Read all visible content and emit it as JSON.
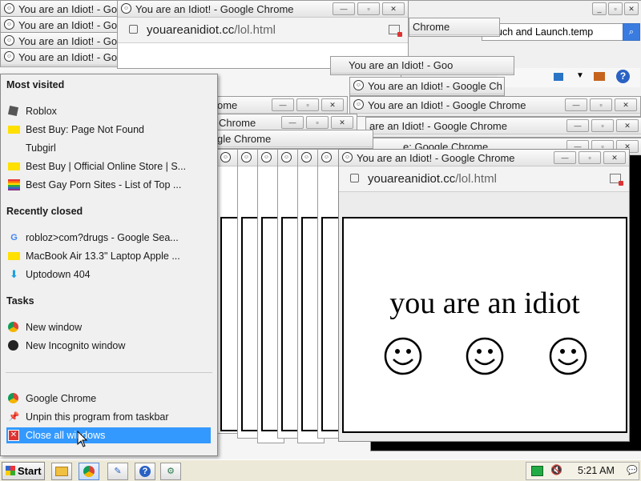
{
  "window_title": "You are an Idiot! - Google Chrome",
  "window_title_short": "You are an Idiot! - Goo",
  "window_title_tail": "You are an Idiot! - Google Ch",
  "window_title_frag_a": "are an Idiot! - Google Chrome",
  "window_title_frag_b": "e: Google Chrome",
  "window_title_frag_c": "Google Chrome",
  "title_frag_chrome": "Chrome",
  "title_frag_gle": "gle Chrome",
  "title_frag_ome": "ome",
  "url_domain": "youareanidiot.cc",
  "url_path": "/lol.html",
  "background_app_text": "uch and Launch.temp",
  "page": {
    "headline": "you are an idiot",
    "smileys": [
      "☺",
      "☺",
      "☺"
    ]
  },
  "jump_list": {
    "most_visited_header": "Most visited",
    "most_visited": [
      {
        "label": "Roblox",
        "icon": "roblox-icon"
      },
      {
        "label": "Best Buy: Page Not Found",
        "icon": "bestbuy-icon"
      },
      {
        "label": "Tubgirl",
        "icon": ""
      },
      {
        "label": "Best Buy | Official Online Store | S...",
        "icon": "bestbuy-icon"
      },
      {
        "label": "Best Gay Porn Sites - List of Top ...",
        "icon": "rainbow-flag-icon"
      }
    ],
    "recently_closed_header": "Recently closed",
    "recently_closed": [
      {
        "label": "robloz>com?drugs - Google Sea...",
        "icon": "google-icon"
      },
      {
        "label": "MacBook Air 13.3\" Laptop Apple ...",
        "icon": "bestbuy-icon"
      },
      {
        "label": "Uptodown 404",
        "icon": "uptodown-icon"
      }
    ],
    "tasks_header": "Tasks",
    "tasks": [
      {
        "label": "New window",
        "icon": "chrome-icon"
      },
      {
        "label": "New Incognito window",
        "icon": "incognito-icon"
      }
    ],
    "bottom": [
      {
        "label": "Google Chrome",
        "icon": "chrome-icon"
      },
      {
        "label": "Unpin this program from taskbar",
        "icon": "pin-icon"
      },
      {
        "label": "Close all windows",
        "icon": "close-window-icon"
      }
    ]
  },
  "taskbar": {
    "start_label": "Start",
    "clock": "5:21 AM"
  },
  "colors": {
    "highlight": "#3399ff",
    "bestbuy_yellow": "#ffe000",
    "close_red": "#d33333"
  }
}
